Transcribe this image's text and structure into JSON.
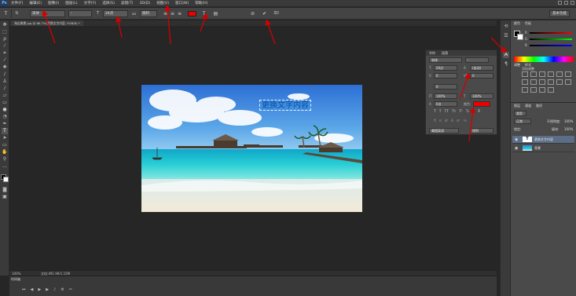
{
  "app": {
    "logo": "Ps",
    "menus": [
      "文件(F)",
      "编辑(E)",
      "图像(I)",
      "图层(L)",
      "文字(Y)",
      "选择(S)",
      "滤镜(T)",
      "3D(D)",
      "视图(V)",
      "窗口(W)",
      "帮助(H)"
    ]
  },
  "options_bar": {
    "font_family": "宋体",
    "font_style": "-",
    "font_size": "24点",
    "anti_alias": "锐利",
    "essentials": "基本功能"
  },
  "document_tab": {
    "label": "海边美景.jpg @ 66.7%(更换文字内容, RGB/8) *"
  },
  "canvas_text": "更换文字内容",
  "status": {
    "zoom": "100%",
    "doc_info": "文档:491.9K/1.15M"
  },
  "timeline": {
    "title": "时间轴"
  },
  "character_panel": {
    "tabs": [
      "字符",
      "段落"
    ],
    "font_family": "宋体",
    "font_style": "-",
    "font_size": "24点",
    "leading": "(自动)",
    "kerning": "0",
    "tracking": "0",
    "vertical_scale": "100%",
    "horizontal_scale": "100%",
    "baseline": "0点",
    "color_label": "颜色:",
    "text_color": "#ff0000",
    "language": "美国英语",
    "anti_alias": "锐利"
  },
  "color_panel": {
    "tabs": [
      "颜色",
      "色板"
    ],
    "channels": [
      {
        "label": "R",
        "value": "0"
      },
      {
        "label": "G",
        "value": "0"
      },
      {
        "label": "B",
        "value": "0"
      }
    ]
  },
  "adjust_panel": {
    "tabs": [
      "调整",
      "样式"
    ],
    "title": "添加调整"
  },
  "layers_panel": {
    "tabs": [
      "图层",
      "通道",
      "路径"
    ],
    "kind": "类型",
    "blend": "正常",
    "opacity_label": "不透明度:",
    "opacity": "100%",
    "lock_label": "锁定:",
    "fill_label": "填充:",
    "fill": "100%",
    "layers": [
      {
        "name": "更换文字内容",
        "type": "T"
      },
      {
        "name": "背景",
        "type": "img"
      }
    ]
  },
  "colors": {
    "accent_arrows": "#d40000",
    "ui_bg": "#262626"
  }
}
